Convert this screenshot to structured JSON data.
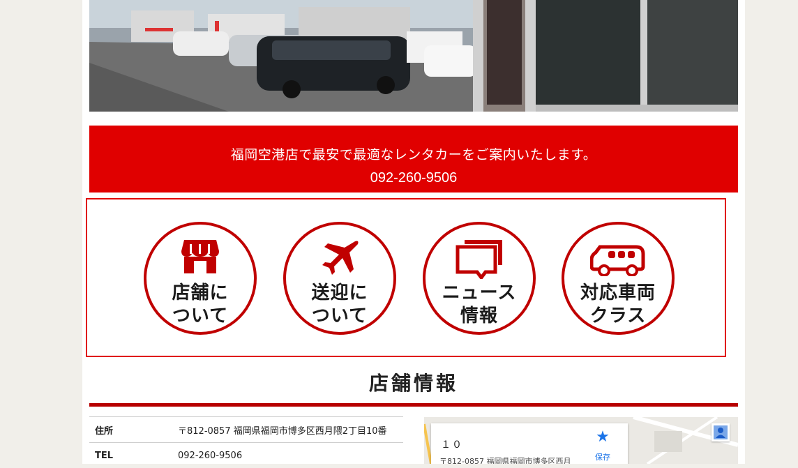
{
  "banner": {
    "tagline": "福岡空港店で最安で最適なレンタカーをご案内いたします。",
    "phone": "092-260-9506"
  },
  "nav": {
    "items": [
      {
        "icon": "shop-icon",
        "line1": "店舗に",
        "line2": "ついて"
      },
      {
        "icon": "airplane-icon",
        "line1": "送迎に",
        "line2": "ついて"
      },
      {
        "icon": "speech-bubbles-icon",
        "line1": "ニュース",
        "line2": "情報"
      },
      {
        "icon": "van-icon",
        "line1": "対応車両",
        "line2": "クラス"
      }
    ]
  },
  "section": {
    "title": "店舗情報"
  },
  "info": {
    "rows": [
      {
        "label": "住所",
        "value": "〒812-0857 福岡県福岡市博多区西月隈2丁目10番"
      },
      {
        "label": "TEL",
        "value": "092-260-9506"
      }
    ]
  },
  "map": {
    "place_name": "１０",
    "address": "〒812-0857 福岡県福岡市博多区西月",
    "save_label": "保存",
    "save_icon": "star-icon",
    "person_icon": "person-icon"
  },
  "colors": {
    "brand_red": "#e00000",
    "dark_red": "#c00000",
    "save_blue": "#1a73e8"
  }
}
